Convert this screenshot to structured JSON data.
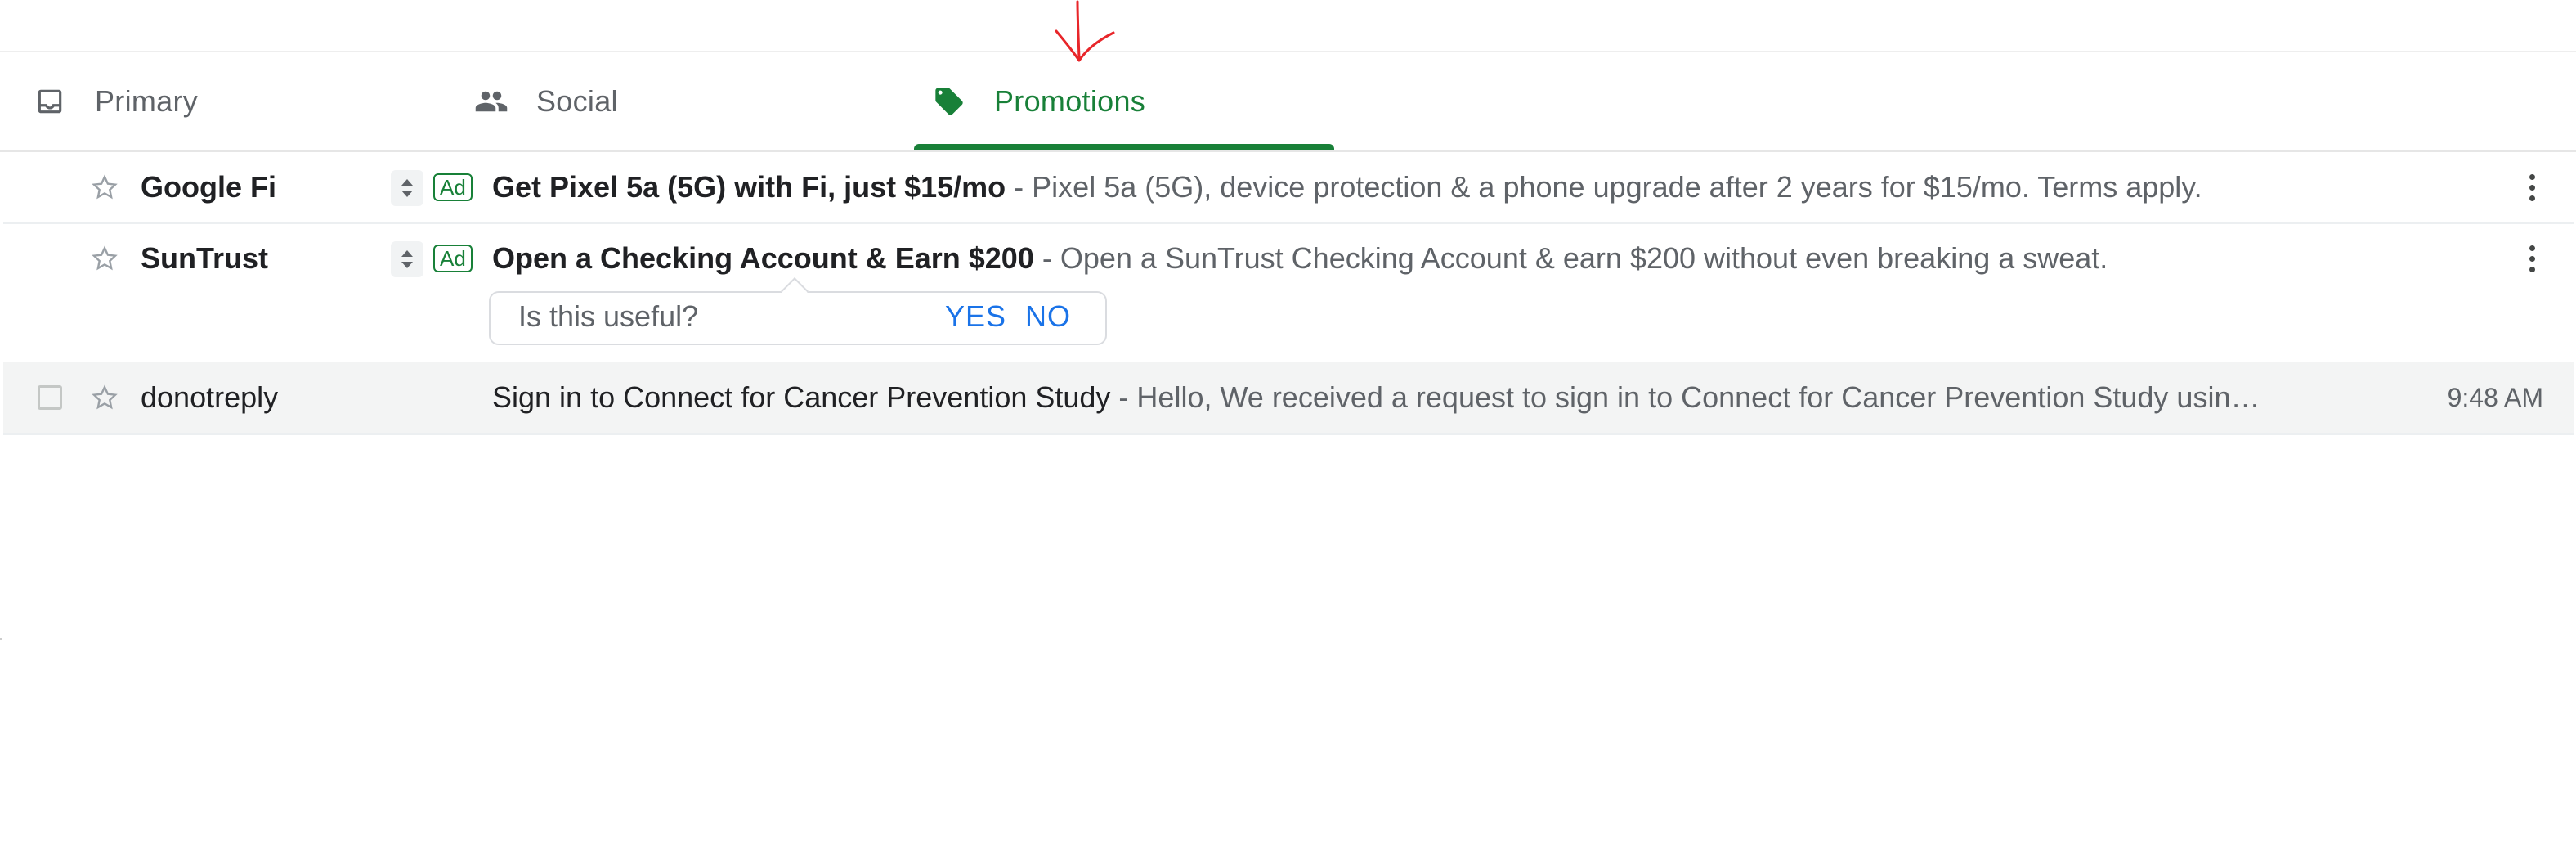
{
  "tabs": [
    {
      "label": "Primary",
      "icon": "inbox-icon",
      "active": false
    },
    {
      "label": "Social",
      "icon": "people-icon",
      "active": false
    },
    {
      "label": "Promotions",
      "icon": "tag-icon",
      "active": true
    }
  ],
  "emails": [
    {
      "sender": "Google Fi",
      "ad_label": "Ad",
      "subject": "Get Pixel 5a (5G) with Fi, just $15/mo",
      "snippet": "Pixel 5a (5G), device protection & a phone upgrade after 2 years for $15/mo. Terms apply."
    },
    {
      "sender": "SunTrust",
      "ad_label": "Ad",
      "subject": "Open a Checking Account & Earn $200",
      "snippet": "Open a SunTrust Checking Account & earn $200 without even breaking a sweat."
    },
    {
      "sender": "donotreply",
      "subject": "Sign in to Connect for Cancer Prevention Study",
      "snippet": "Hello, We received a request to sign in to Connect for Cancer Prevention Study usin…",
      "time": "9:48 AM"
    }
  ],
  "separator": " - ",
  "feedback": {
    "question": "Is this useful?",
    "yes": "YES",
    "no": "NO"
  },
  "colors": {
    "accent_green": "#188038",
    "link_blue": "#1a73e8",
    "annotation_red": "#e8262a"
  }
}
